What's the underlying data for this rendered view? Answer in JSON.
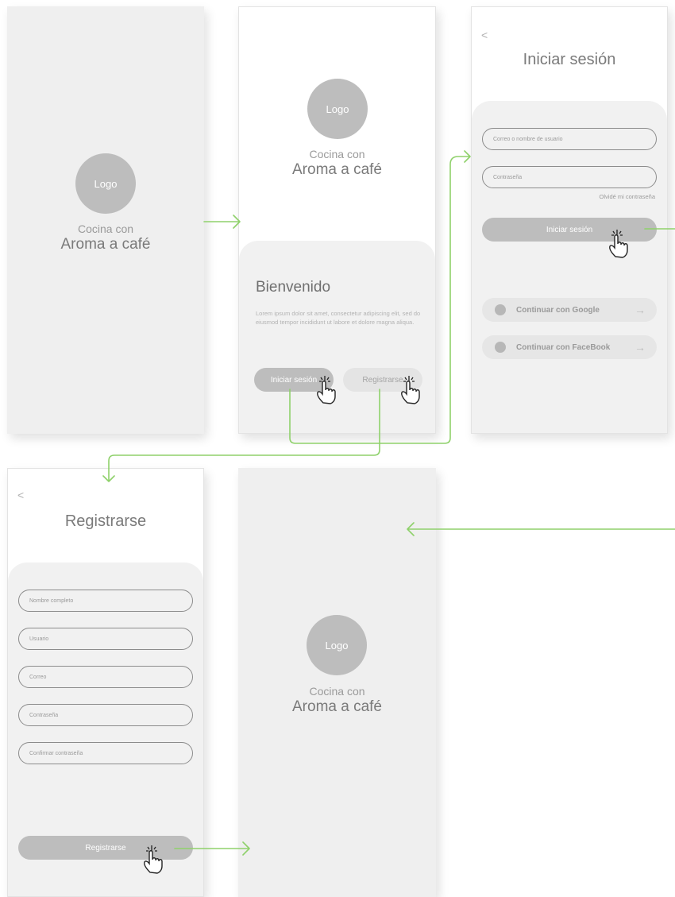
{
  "brand": {
    "logo": "Logo",
    "line1": "Cocina con",
    "line2": "Aroma a café"
  },
  "welcome": {
    "title": "Bienvenido",
    "body": "Lorem ipsum dolor sit amet, consectetur adipiscing elit, sed do eiusmod tempor incididunt ut labore et dolore magna aliqua.",
    "login_button": "Iniciar sesión",
    "register_button": "Registrarse"
  },
  "login": {
    "back": "<",
    "title": "Iniciar sesión",
    "user_placeholder": "Correo o nombre de usuario",
    "password_placeholder": "Contraseña",
    "forgot": "Olvidé mi contraseña",
    "submit": "Iniciar sesión",
    "google": "Continuar con Google",
    "facebook": "Continuar con FaceBook",
    "arrow": "→"
  },
  "register": {
    "back": "<",
    "title": "Registrarse",
    "fields": [
      "Nombre completo",
      "Usuario",
      "Correo",
      "Contraseña",
      "Confirmar contraseña"
    ],
    "submit": "Registrarse"
  },
  "colors": {
    "flow_arrow": "#8fd16b",
    "screen_gray": "#efefef",
    "button_gray": "#bdbdbd"
  },
  "icons": [
    "hand-tap-icon",
    "back-chevron-icon",
    "arrow-right-icon",
    "social-dot-icon"
  ]
}
